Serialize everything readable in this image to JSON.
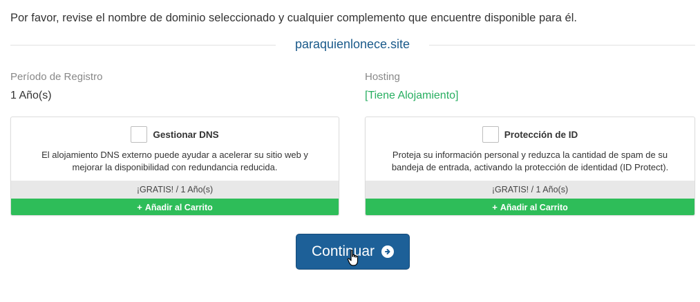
{
  "intro_text": "Por favor, revise el nombre de dominio seleccionado y cualquier complemento que encuentre disponible para él.",
  "domain": "paraquienlonece.site",
  "registration": {
    "label": "Período de Registro",
    "value": "1 Año(s)"
  },
  "hosting": {
    "label": "Hosting",
    "value": "[Tiene Alojamiento]",
    "value_color": "#27ae60"
  },
  "addons": [
    {
      "title": "Gestionar DNS",
      "checked": false,
      "description_line1": "El alojamiento DNS externo puede ayudar a acelerar su sitio web y",
      "description_line2": "mejorar la disponibilidad con redundancia reducida.",
      "price": "¡GRATIS! / 1 Año(s)",
      "add_label": "Añadir al Carrito",
      "add_icon": "plus-icon"
    },
    {
      "title": "Protección de ID",
      "checked": false,
      "description_line1": "Proteja su información personal y reduzca la cantidad de spam de su",
      "description_line2": "bandeja de entrada, activando la protección de identidad (ID Protect).",
      "price": "¡GRATIS! / 1 Año(s)",
      "add_label": "Añadir al Carrito",
      "add_icon": "plus-icon"
    }
  ],
  "continue_button": {
    "label": "Continuar",
    "icon": "arrow-circle-right-icon"
  },
  "colors": {
    "domain_text": "#1a5a8a",
    "add_button": "#2ebd59",
    "continue_button": "#1d6098"
  }
}
